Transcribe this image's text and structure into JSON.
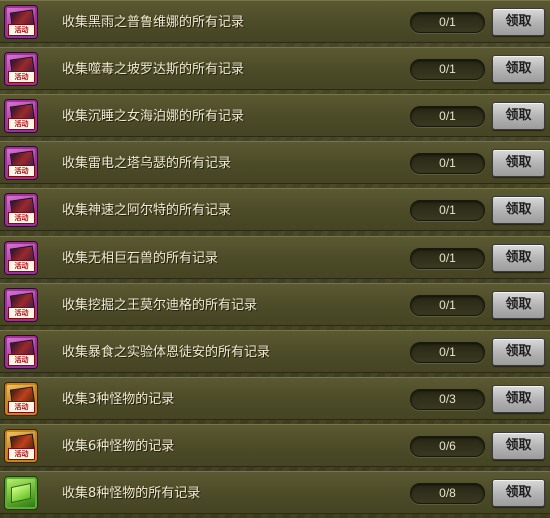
{
  "rows": [
    {
      "icon": "purple-card-icon",
      "badge": "活动",
      "title": "收集黑雨之普鲁维娜的所有记录",
      "progress": "0/1",
      "done": 0,
      "total": 1,
      "button": "领取"
    },
    {
      "icon": "purple-card-icon",
      "badge": "活动",
      "title": "收集噬毒之坡罗达斯的所有记录",
      "progress": "0/1",
      "done": 0,
      "total": 1,
      "button": "领取"
    },
    {
      "icon": "purple-card-icon",
      "badge": "活动",
      "title": "收集沉睡之女海泊娜的所有记录",
      "progress": "0/1",
      "done": 0,
      "total": 1,
      "button": "领取"
    },
    {
      "icon": "purple-card-icon",
      "badge": "活动",
      "title": "收集雷电之塔乌瑟的所有记录",
      "progress": "0/1",
      "done": 0,
      "total": 1,
      "button": "领取"
    },
    {
      "icon": "purple-card-icon",
      "badge": "活动",
      "title": "收集神速之阿尔特的所有记录",
      "progress": "0/1",
      "done": 0,
      "total": 1,
      "button": "领取"
    },
    {
      "icon": "purple-card-icon",
      "badge": "活动",
      "title": "收集无相巨石兽的所有记录",
      "progress": "0/1",
      "done": 0,
      "total": 1,
      "button": "领取"
    },
    {
      "icon": "purple-card-icon",
      "badge": "活动",
      "title": "收集挖掘之王莫尔迪格的所有记录",
      "progress": "0/1",
      "done": 0,
      "total": 1,
      "button": "领取"
    },
    {
      "icon": "purple-card-icon",
      "badge": "活动",
      "title": "收集暴食之实验体恩徒安的所有记录",
      "progress": "0/1",
      "done": 0,
      "total": 1,
      "button": "领取"
    },
    {
      "icon": "gold-card-icon",
      "badge": "活动",
      "title": "收集3种怪物的记录",
      "progress": "0/3",
      "done": 0,
      "total": 3,
      "button": "领取"
    },
    {
      "icon": "gold-card-icon",
      "badge": "活动",
      "title": "收集6种怪物的记录",
      "progress": "0/6",
      "done": 0,
      "total": 6,
      "button": "领取"
    },
    {
      "icon": "green-cube-icon",
      "badge": "",
      "title": "收集8种怪物的所有记录",
      "progress": "0/8",
      "done": 0,
      "total": 8,
      "button": "领取"
    }
  ]
}
